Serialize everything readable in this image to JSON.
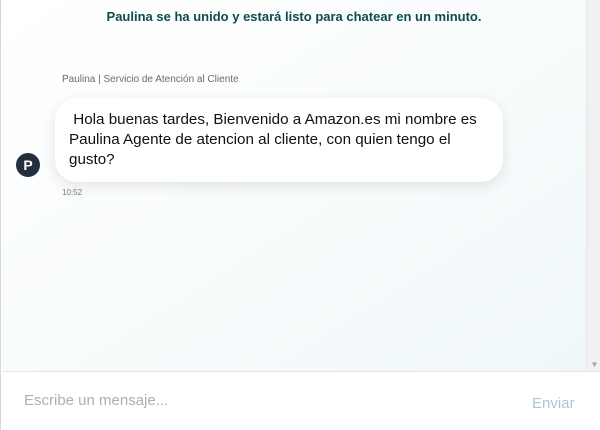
{
  "chat": {
    "system_message": "Paulina se ha unido y estará listo para chatear en un minuto.",
    "agent": {
      "header": "Paulina | Servicio de Atención al Cliente",
      "avatar_initial": "P"
    },
    "messages": [
      {
        "sender": "agent",
        "text": " Hola buenas tardes, Bienvenido a Amazon.es mi nombre es\nPaulina Agente de atencion al cliente, con quien tengo el\ngusto?",
        "time": "10:52"
      }
    ]
  },
  "composer": {
    "placeholder": "Escribe un mensaje...",
    "value": "",
    "send_label": "Enviar"
  },
  "scrollbar": {
    "down_arrow_icon": "chevron-down-icon"
  },
  "colors": {
    "system_text": "#0f4a4c",
    "avatar_bg": "#232f3e",
    "send_disabled": "#a9c8d3"
  }
}
